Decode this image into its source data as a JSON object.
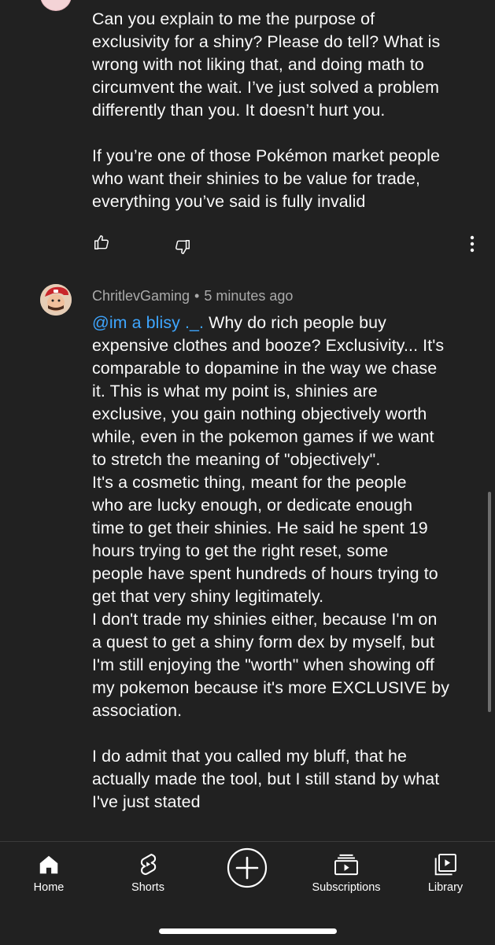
{
  "comment_1": {
    "text": "Can you explain to me the purpose of\nexclusivity for a shiny? Please do tell? What is\nwrong with not liking that, and doing math to\ncircumvent the wait. I’ve just solved a problem\ndifferently than you. It doesn’t hurt you.\n\nIf you’re one of those Pokémon market people\nwho want their shinies to be value for trade,\neverything you’ve said is fully invalid",
    "actions": {
      "like_icon": "thumbs-up-icon",
      "dislike_icon": "thumbs-down-icon",
      "more_icon": "more-vert-icon"
    }
  },
  "comment_2": {
    "author": "ChritlevGaming",
    "separator": "•",
    "time": "5 minutes ago",
    "mention": " @im a blisy ._.",
    "text_after_mention": "  Why do rich people buy\nexpensive clothes and booze? Exclusivity... It's\ncomparable to dopamine in the way we chase\nit. This is what my point is, shinies are\nexclusive, you gain nothing objectively worth\nwhile, even in the pokemon games if we want\nto stretch the meaning of \"objectively\".\nIt's a cosmetic thing, meant for the people\nwho are lucky enough, or dedicate enough\ntime to get their shinies. He said he spent 19\nhours trying to get the right reset, some\npeople have spent hundreds of hours trying to\nget that very shiny legitimately.\nI don't trade my shinies either, because I'm on\na quest to get a shiny form dex by myself, but\nI'm still enjoying the \"worth\" when showing off\nmy pokemon because it's more EXCLUSIVE by\nassociation.\n\nI do admit that you called my bluff, that he\nactually made the tool, but I still stand by what\nI've just stated"
  },
  "bottom_nav": [
    {
      "label": "Home",
      "icon": "home-icon"
    },
    {
      "label": "Shorts",
      "icon": "shorts-icon"
    },
    {
      "label": "",
      "icon": "create-icon"
    },
    {
      "label": "Subscriptions",
      "icon": "subscriptions-icon"
    },
    {
      "label": "Library",
      "icon": "library-icon"
    }
  ],
  "colors": {
    "background": "#212121",
    "text": "#ffffff",
    "secondary_text": "#aaaaaa",
    "mention": "#3ea6ff"
  }
}
